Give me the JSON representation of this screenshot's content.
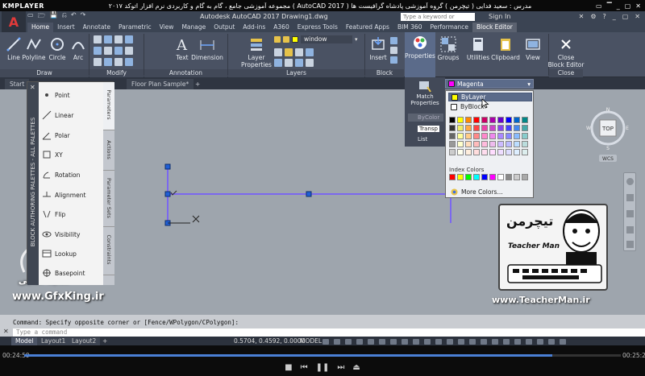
{
  "player": {
    "brand": "KMPLAYER",
    "course_title": "مجموعه آموزشی جامع ، گام به گام و کاربردی نرم افزار اتوکد ۲۰۱۷ ( AutoCAD 2017 ) مدرس : سعید فدایی ( تیچرمن ) گروه آموزشی پادشاه گرافیست ها",
    "time_elapsed": "00:24:59",
    "time_total": "00:25:28",
    "progress": 0.885,
    "window_buttons": [
      "▭",
      "▔",
      "_",
      "▢",
      "✕"
    ]
  },
  "acad": {
    "app_button": "A",
    "qat": [
      "▭",
      "🗁",
      "💾",
      "⎌",
      "↶",
      "↷"
    ],
    "doc_title": "Autodesk AutoCAD 2017    Drawing1.dwg",
    "search_placeholder": "Type a keyword or phrase",
    "signin": "Sign In",
    "title_right": [
      "✕",
      "⚙",
      "?",
      "_",
      "▢",
      "✕"
    ]
  },
  "tabs": [
    "Home",
    "Insert",
    "Annotate",
    "Parametric",
    "View",
    "Manage",
    "Output",
    "Add-ins",
    "A360",
    "Express Tools",
    "Featured Apps",
    "BIM 360",
    "Performance",
    "Block Editor"
  ],
  "ribbon": {
    "draw_tools": [
      "Line",
      "Polyline",
      "Circle",
      "Arc"
    ],
    "text_tool": "Text",
    "dimension_tool": "Dimension",
    "layer_properties": "Layer\nProperties",
    "layer_name": "window",
    "insert": "Insert",
    "properties": "Properties",
    "groups": "Groups",
    "utilities": "Utilities",
    "clipboard": "Clipboard",
    "view": "View",
    "close_block_editor": "Close\nBlock Editor",
    "panels": [
      "Draw",
      "Modify",
      "Annotation",
      "Layers",
      "Block",
      "Close"
    ]
  },
  "doctabs": [
    "Start",
    "Floor Plan Sample*"
  ],
  "palette": {
    "title": "BLOCK AUTHORING PALETTES - ALL PALETTES",
    "items": [
      "Point",
      "Linear",
      "Polar",
      "XY",
      "Rotation",
      "Alignment",
      "Flip",
      "Visibility",
      "Lookup",
      "Basepoint"
    ],
    "tabs": [
      "Parameters",
      "Actions",
      "Parameter Sets",
      "Constraints"
    ]
  },
  "props_panel": {
    "match": "Match\nProperties",
    "bycolor": "ByColor",
    "transp": "Transp",
    "list": "List",
    "selected_color": "Magenta",
    "options": [
      "ByLayer",
      "ByBlock"
    ],
    "index_colors_label": "Index Colors",
    "more_colors": "More Colors..."
  },
  "viewcube": {
    "top": "TOP",
    "n": "N",
    "s": "S",
    "e": "E",
    "w": "W",
    "wcs": "WCS"
  },
  "command": {
    "history": "Command: Specify opposite corner or [Fence/WPolygon/CPolygon]:",
    "placeholder": "Type a command"
  },
  "layouts": [
    "Model",
    "Layout1",
    "Layout2"
  ],
  "status": {
    "coords": "0.5704, 0.4592, 0.0000",
    "model": "MODEL"
  },
  "watermarks": {
    "author_name": "سعید فدایی",
    "gfxking": "www.GfxKing.ir",
    "teacherman_url": "www.TeacherMan.ir",
    "teacherman_brand": "Teacher Man",
    "teacherman_fa": "تیچرمن"
  },
  "colors": {
    "ribbon_bg": "#4a5263",
    "canvas_bg": "#9ea5ad",
    "block_line": "#7b68ee",
    "grip": "#1f5fd6",
    "magenta": "#ff00ff",
    "bylayer": "#ffff00"
  }
}
